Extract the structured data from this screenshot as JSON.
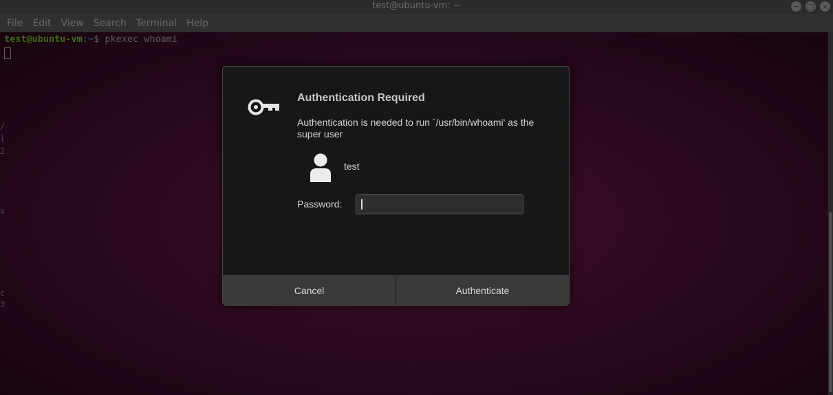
{
  "window": {
    "title": "test@ubuntu-vm: ~",
    "controls": [
      "−",
      "□",
      "×"
    ]
  },
  "menubar": {
    "items": [
      "File",
      "Edit",
      "View",
      "Search",
      "Terminal",
      "Help"
    ]
  },
  "terminal": {
    "prompt_user": "test@ubuntu-vm",
    "prompt_sep": ":",
    "prompt_path": "~",
    "prompt_symbol": "$ ",
    "command": "pkexec whoami",
    "edge_glyphs": [
      "/",
      "l",
      "2",
      "v",
      "c",
      "3"
    ]
  },
  "dialog": {
    "title": "Authentication Required",
    "message": "Authentication is needed to run `/usr/bin/whoami' as the super user",
    "user": "test",
    "password_label": "Password:",
    "password_value": "",
    "cancel_label": "Cancel",
    "authenticate_label": "Authenticate",
    "icons": {
      "header": "key-icon",
      "user": "user-avatar-icon"
    }
  },
  "colors": {
    "terminal_bg": "#300a24",
    "prompt_user": "#3d6a1a",
    "prompt_path": "#2d4f73",
    "dialog_bg": "#171717",
    "button_bg": "#393939"
  }
}
